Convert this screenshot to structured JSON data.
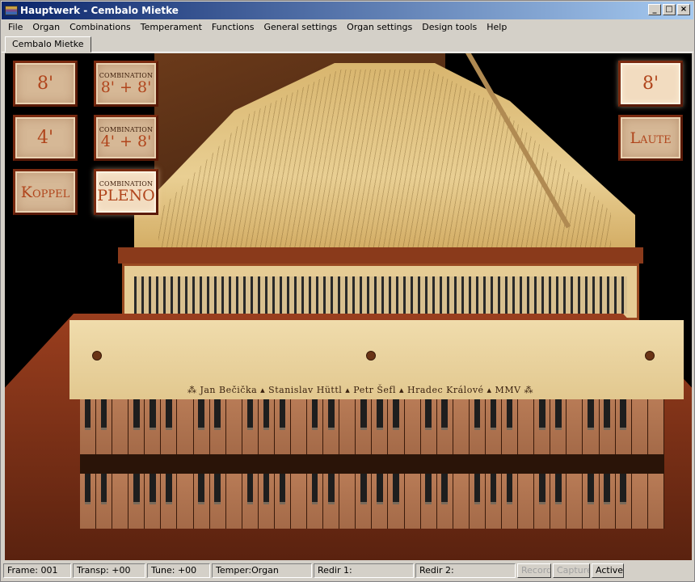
{
  "window": {
    "title": "Hauptwerk - Cembalo Mietke",
    "buttons": {
      "minimize": "_",
      "maximize": "□",
      "close": "×"
    }
  },
  "menu": [
    "File",
    "Organ",
    "Combinations",
    "Temperament",
    "Functions",
    "General settings",
    "Organ settings",
    "Design tools",
    "Help"
  ],
  "tabs": [
    {
      "label": "Cembalo Mietke",
      "active": true
    }
  ],
  "stops_left": [
    {
      "label": "8'"
    },
    {
      "label": "4'"
    },
    {
      "label": "Koppel"
    }
  ],
  "combinations": [
    {
      "caption": "COMBINATION",
      "label": "8' + 8'"
    },
    {
      "caption": "COMBINATION",
      "label": "4' + 8'"
    },
    {
      "caption": "COMBINATION",
      "label": "PLENO",
      "on": true
    }
  ],
  "stops_right": [
    {
      "label": "8'",
      "on": true
    },
    {
      "label": "Laute"
    }
  ],
  "nameboard": {
    "maker_text": "⁂ Jan Bečička ▴ Stanislav Hüttl ▴ Petr Šefl ▴ Hradec Králové ▴ MMV ⁂"
  },
  "status": {
    "frame": "Frame: 001",
    "transp": "Transp: +00",
    "tune": "Tune: +00",
    "temper": "Temper:Organ",
    "redir1": "Redir 1:",
    "redir2": "Redir 2:",
    "record": "Record",
    "capture": "Capture",
    "active": "Active"
  }
}
